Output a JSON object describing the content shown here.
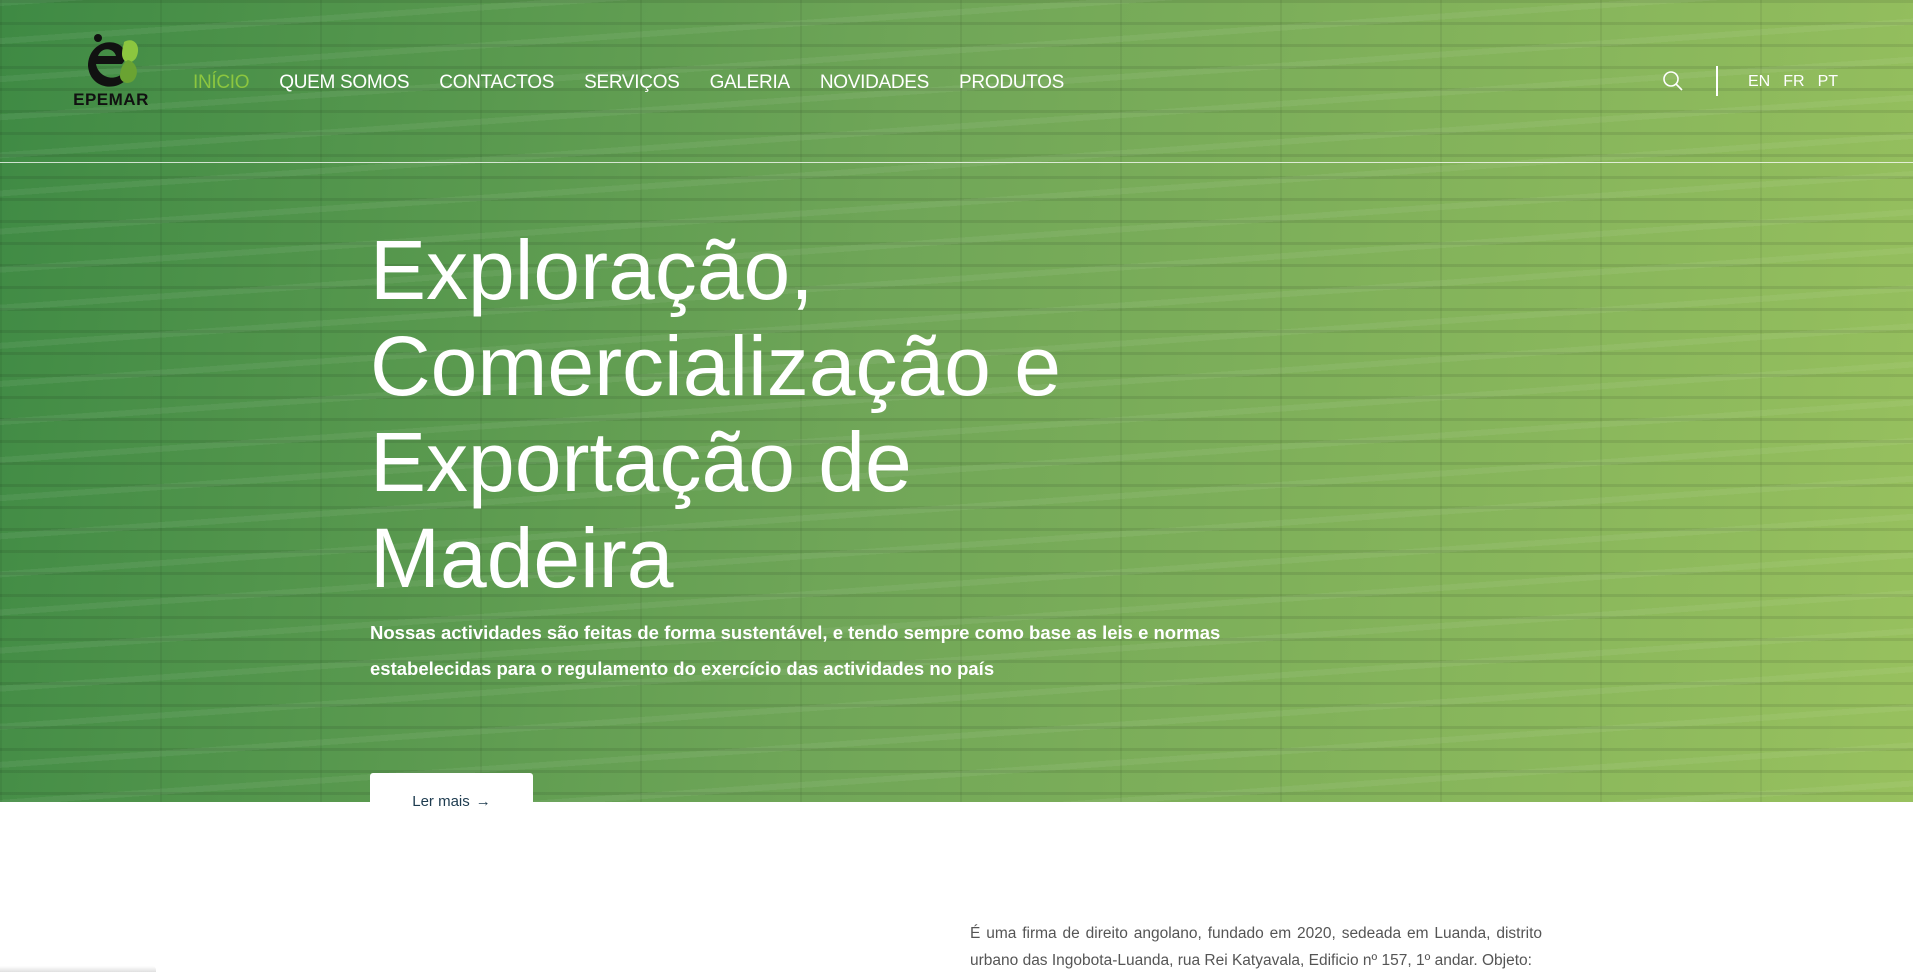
{
  "brand": {
    "name": "EPEMAR",
    "colors": {
      "primary_green": "#2e8034",
      "light_green": "#8cc63f",
      "text_dark": "#1d3b4f"
    }
  },
  "nav": {
    "items": [
      {
        "label": "INÍCIO",
        "active": true
      },
      {
        "label": "QUEM SOMOS",
        "active": false
      },
      {
        "label": "CONTACTOS",
        "active": false
      },
      {
        "label": "SERVIÇOS",
        "active": false
      },
      {
        "label": "GALERIA",
        "active": false
      },
      {
        "label": "NOVIDADES",
        "active": false
      },
      {
        "label": "PRODUTOS",
        "active": false
      }
    ]
  },
  "header_tools": {
    "search_icon": "search-icon",
    "languages": [
      "EN",
      "FR",
      "PT"
    ]
  },
  "hero": {
    "title": "Exploração, Comercialização e Exportação de Madeira",
    "subtitle": "Nossas actividades são feitas de forma sustentável, e tendo sempre como base as leis e normas estabelecidas para o regulamento do exercício das actividades no país",
    "cta_label": "Ler mais",
    "cta_icon": "arrow-right-icon"
  },
  "about": {
    "text": "É uma firma de direito angolano, fundado em 2020, sedeada em Luanda, distrito urbano das Ingobota-Luanda, rua Rei Katyavala, Edificio nº 157, 1º andar. Objeto:"
  }
}
